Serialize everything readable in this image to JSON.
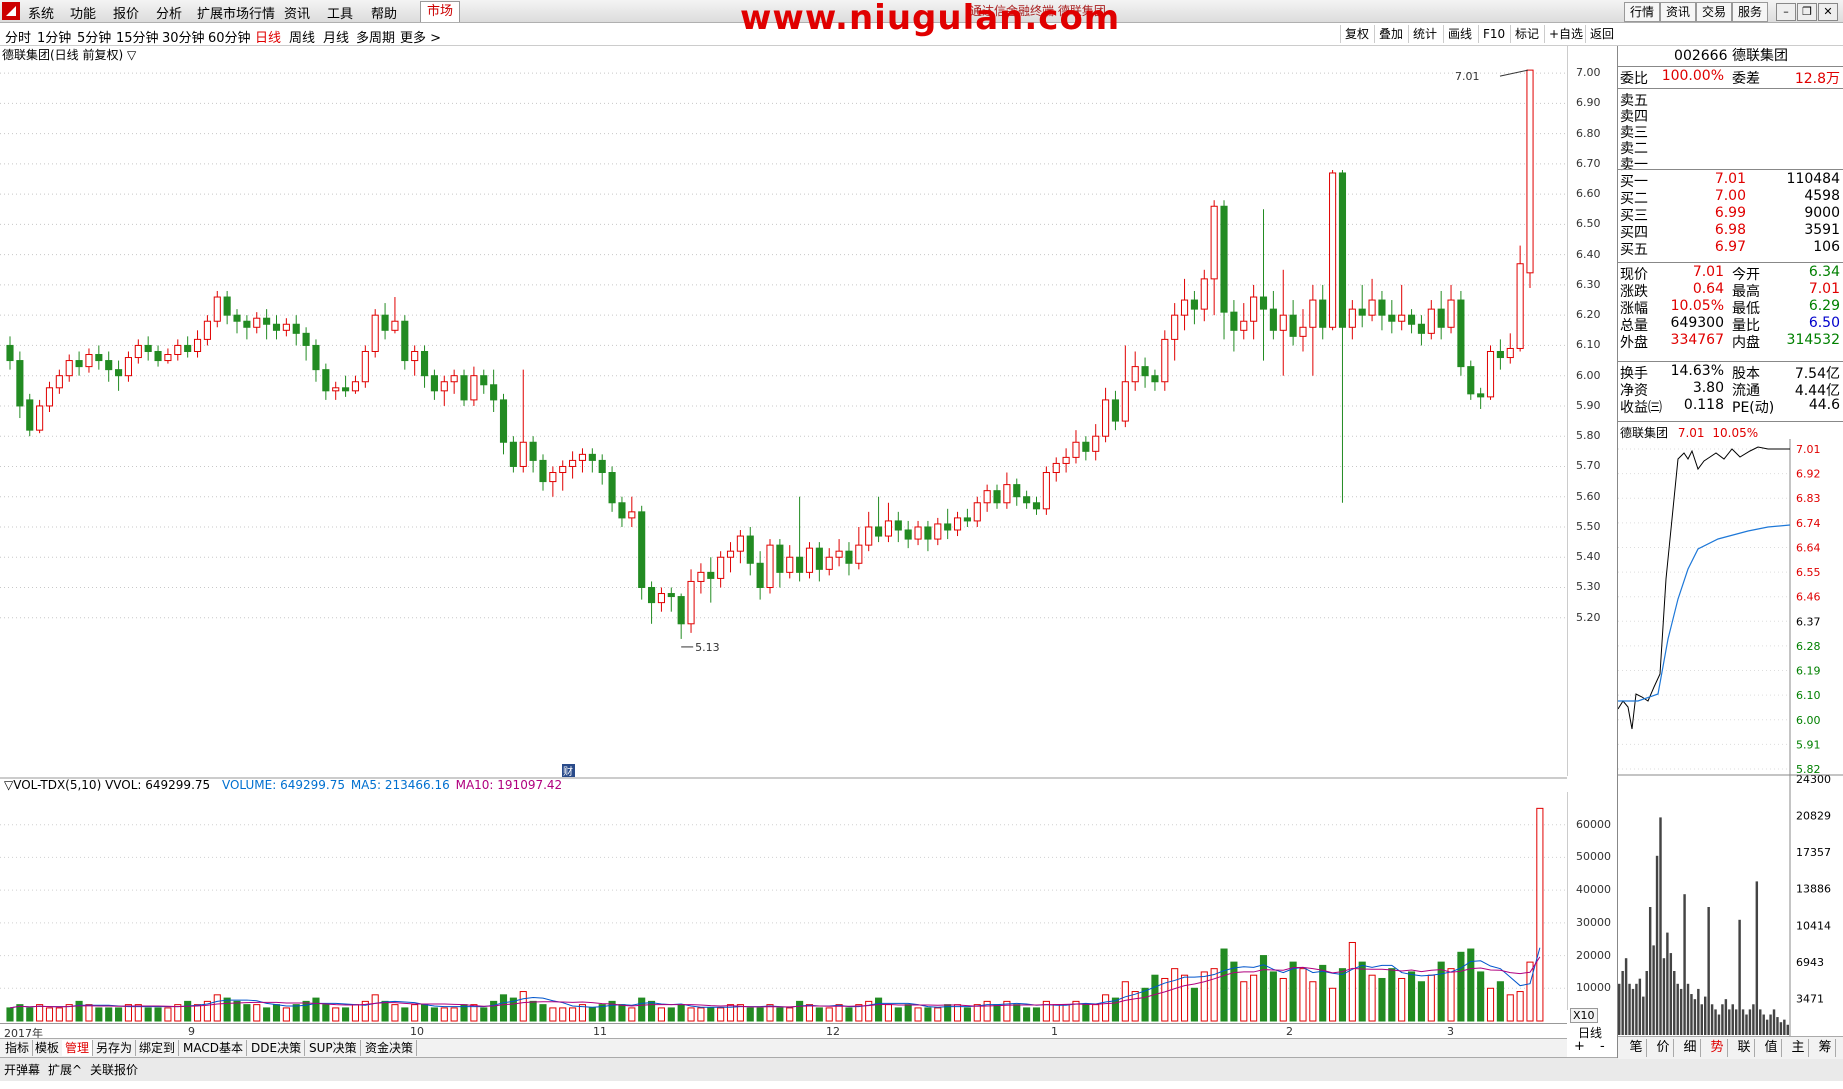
{
  "menu": {
    "items": [
      "系统",
      "功能",
      "报价",
      "分析",
      "扩展市场行情",
      "资讯",
      "工具",
      "帮助"
    ],
    "active": "市场",
    "watermark": "www.niugulan.com",
    "subtitle": "通达信金融终端 德联集团",
    "right_buttons": [
      "行情",
      "资讯",
      "交易",
      "服务"
    ]
  },
  "periodbar": {
    "periods": [
      "分时",
      "1分钟",
      "5分钟",
      "15分钟",
      "30分钟",
      "60分钟",
      "日线",
      "周线",
      "月线",
      "多周期",
      "更多 >"
    ],
    "active_period": "日线",
    "tools": [
      "复权",
      "叠加",
      "统计",
      "画线",
      "F10",
      "标记",
      "+自选",
      "返回"
    ]
  },
  "chart": {
    "title": "德联集团(日线 前复权) ▽",
    "price_labels": [
      "7.00",
      "6.90",
      "6.80",
      "6.70",
      "6.60",
      "6.50",
      "6.40",
      "6.30",
      "6.20",
      "6.10",
      "6.00",
      "5.90",
      "5.80",
      "5.70",
      "5.60",
      "5.50",
      "5.40",
      "5.30",
      "5.20"
    ],
    "high_marker": "7.01",
    "low_marker": "5.13",
    "finance_marker": "财",
    "vol_title_prefix": "▽VOL-TDX(5,10) VVOL: 649299.75",
    "vol_volume": "VOLUME: 649299.75",
    "vol_ma5": "MA5: 213466.16",
    "vol_ma10": "MA10: 191097.42",
    "vol_axis_labels": [
      "60000",
      "50000",
      "40000",
      "30000",
      "20000",
      "10000"
    ],
    "vol_unit": "X10",
    "date_labels": [
      "2017年",
      "9",
      "10",
      "11",
      "12",
      "1",
      "2",
      "3"
    ],
    "period_label": "日线",
    "colors": {
      "up": "#e00000",
      "down": "#228b22",
      "ma5": "#0055cc",
      "ma10": "#b0007f"
    }
  },
  "chart_data": {
    "type": "candlestick",
    "title": "德联集团(日线 前复权)",
    "ylim": [
      5.1,
      7.05
    ],
    "candles": [
      [
        6.1,
        6.05,
        6.13,
        6.02
      ],
      [
        6.05,
        5.9,
        6.08,
        5.86
      ],
      [
        5.92,
        5.82,
        5.94,
        5.8
      ],
      [
        5.82,
        5.9,
        5.92,
        5.81
      ],
      [
        5.9,
        5.96,
        5.98,
        5.88
      ],
      [
        5.96,
        6.0,
        6.02,
        5.94
      ],
      [
        6.0,
        6.05,
        6.07,
        5.98
      ],
      [
        6.05,
        6.03,
        6.08,
        6.0
      ],
      [
        6.03,
        6.07,
        6.09,
        6.01
      ],
      [
        6.07,
        6.05,
        6.1,
        6.02
      ],
      [
        6.05,
        6.02,
        6.08,
        5.98
      ],
      [
        6.02,
        6.0,
        6.05,
        5.95
      ],
      [
        6.0,
        6.06,
        6.08,
        5.98
      ],
      [
        6.06,
        6.1,
        6.12,
        6.04
      ],
      [
        6.1,
        6.08,
        6.13,
        6.05
      ],
      [
        6.08,
        6.05,
        6.1,
        6.03
      ],
      [
        6.05,
        6.07,
        6.09,
        6.04
      ],
      [
        6.07,
        6.1,
        6.12,
        6.05
      ],
      [
        6.1,
        6.08,
        6.13,
        6.06
      ],
      [
        6.08,
        6.12,
        6.15,
        6.06
      ],
      [
        6.12,
        6.18,
        6.2,
        6.1
      ],
      [
        6.18,
        6.26,
        6.28,
        6.16
      ],
      [
        6.26,
        6.2,
        6.28,
        6.17
      ],
      [
        6.2,
        6.18,
        6.22,
        6.14
      ],
      [
        6.18,
        6.16,
        6.2,
        6.12
      ],
      [
        6.16,
        6.19,
        6.21,
        6.14
      ],
      [
        6.19,
        6.17,
        6.22,
        6.12
      ],
      [
        6.17,
        6.15,
        6.2,
        6.12
      ],
      [
        6.15,
        6.17,
        6.19,
        6.13
      ],
      [
        6.17,
        6.14,
        6.2,
        6.1
      ],
      [
        6.14,
        6.1,
        6.16,
        6.05
      ],
      [
        6.1,
        6.02,
        6.12,
        5.98
      ],
      [
        6.02,
        5.95,
        6.04,
        5.92
      ],
      [
        5.95,
        5.96,
        5.98,
        5.92
      ],
      [
        5.96,
        5.95,
        6.0,
        5.93
      ],
      [
        5.95,
        5.98,
        6.0,
        5.94
      ],
      [
        5.98,
        6.08,
        6.1,
        5.96
      ],
      [
        6.08,
        6.2,
        6.22,
        6.06
      ],
      [
        6.2,
        6.15,
        6.24,
        6.12
      ],
      [
        6.15,
        6.18,
        6.26,
        6.14
      ],
      [
        6.18,
        6.05,
        6.2,
        6.02
      ],
      [
        6.05,
        6.08,
        6.1,
        6.0
      ],
      [
        6.08,
        6.0,
        6.1,
        5.96
      ],
      [
        6.0,
        5.95,
        6.02,
        5.92
      ],
      [
        5.95,
        5.98,
        6.0,
        5.9
      ],
      [
        5.98,
        6.0,
        6.02,
        5.94
      ],
      [
        6.0,
        5.92,
        6.02,
        5.9
      ],
      [
        5.92,
        6.0,
        6.03,
        5.9
      ],
      [
        6.0,
        5.97,
        6.02,
        5.94
      ],
      [
        5.97,
        5.92,
        6.02,
        5.88
      ],
      [
        5.92,
        5.78,
        5.94,
        5.74
      ],
      [
        5.78,
        5.7,
        5.8,
        5.68
      ],
      [
        5.7,
        5.78,
        6.02,
        5.68
      ],
      [
        5.78,
        5.72,
        5.8,
        5.68
      ],
      [
        5.72,
        5.65,
        5.74,
        5.62
      ],
      [
        5.65,
        5.68,
        5.7,
        5.6
      ],
      [
        5.68,
        5.7,
        5.72,
        5.62
      ],
      [
        5.7,
        5.72,
        5.75,
        5.66
      ],
      [
        5.72,
        5.74,
        5.76,
        5.68
      ],
      [
        5.74,
        5.72,
        5.76,
        5.68
      ],
      [
        5.72,
        5.68,
        5.74,
        5.64
      ],
      [
        5.68,
        5.58,
        5.7,
        5.55
      ],
      [
        5.58,
        5.53,
        5.6,
        5.5
      ],
      [
        5.53,
        5.55,
        5.6,
        5.5
      ],
      [
        5.55,
        5.3,
        5.57,
        5.26
      ],
      [
        5.3,
        5.25,
        5.32,
        5.18
      ],
      [
        5.25,
        5.28,
        5.3,
        5.22
      ],
      [
        5.28,
        5.27,
        5.3,
        5.22
      ],
      [
        5.27,
        5.18,
        5.28,
        5.13
      ],
      [
        5.18,
        5.32,
        5.36,
        5.15
      ],
      [
        5.32,
        5.35,
        5.38,
        5.28
      ],
      [
        5.35,
        5.33,
        5.4,
        5.25
      ],
      [
        5.33,
        5.4,
        5.42,
        5.3
      ],
      [
        5.4,
        5.42,
        5.45,
        5.35
      ],
      [
        5.42,
        5.47,
        5.49,
        5.38
      ],
      [
        5.47,
        5.38,
        5.5,
        5.34
      ],
      [
        5.38,
        5.3,
        5.42,
        5.26
      ],
      [
        5.3,
        5.44,
        5.46,
        5.28
      ],
      [
        5.44,
        5.35,
        5.46,
        5.3
      ],
      [
        5.35,
        5.4,
        5.44,
        5.33
      ],
      [
        5.4,
        5.35,
        5.6,
        5.32
      ],
      [
        5.35,
        5.43,
        5.45,
        5.33
      ],
      [
        5.43,
        5.36,
        5.45,
        5.32
      ],
      [
        5.36,
        5.4,
        5.43,
        5.34
      ],
      [
        5.4,
        5.42,
        5.46,
        5.37
      ],
      [
        5.42,
        5.38,
        5.45,
        5.34
      ],
      [
        5.38,
        5.44,
        5.5,
        5.36
      ],
      [
        5.44,
        5.5,
        5.55,
        5.42
      ],
      [
        5.5,
        5.47,
        5.6,
        5.45
      ],
      [
        5.47,
        5.52,
        5.58,
        5.45
      ],
      [
        5.52,
        5.49,
        5.55,
        5.45
      ],
      [
        5.49,
        5.46,
        5.52,
        5.43
      ],
      [
        5.46,
        5.5,
        5.52,
        5.44
      ],
      [
        5.5,
        5.46,
        5.52,
        5.42
      ],
      [
        5.46,
        5.51,
        5.53,
        5.44
      ],
      [
        5.51,
        5.49,
        5.56,
        5.46
      ],
      [
        5.49,
        5.53,
        5.55,
        5.47
      ],
      [
        5.53,
        5.52,
        5.56,
        5.5
      ],
      [
        5.52,
        5.58,
        5.6,
        5.5
      ],
      [
        5.58,
        5.62,
        5.64,
        5.55
      ],
      [
        5.62,
        5.58,
        5.64,
        5.56
      ],
      [
        5.58,
        5.64,
        5.68,
        5.56
      ],
      [
        5.64,
        5.6,
        5.66,
        5.57
      ],
      [
        5.6,
        5.58,
        5.62,
        5.56
      ],
      [
        5.58,
        5.56,
        5.6,
        5.54
      ],
      [
        5.56,
        5.68,
        5.7,
        5.54
      ],
      [
        5.68,
        5.71,
        5.73,
        5.65
      ],
      [
        5.71,
        5.73,
        5.76,
        5.68
      ],
      [
        5.73,
        5.78,
        5.82,
        5.71
      ],
      [
        5.78,
        5.75,
        5.8,
        5.72
      ],
      [
        5.75,
        5.8,
        5.84,
        5.72
      ],
      [
        5.8,
        5.92,
        5.96,
        5.78
      ],
      [
        5.92,
        5.85,
        5.95,
        5.82
      ],
      [
        5.85,
        5.98,
        6.1,
        5.83
      ],
      [
        5.98,
        6.03,
        6.08,
        5.95
      ],
      [
        6.03,
        6.0,
        6.06,
        5.96
      ],
      [
        6.0,
        5.98,
        6.02,
        5.95
      ],
      [
        5.98,
        6.12,
        6.15,
        5.95
      ],
      [
        6.12,
        6.2,
        6.24,
        6.05
      ],
      [
        6.2,
        6.25,
        6.32,
        6.15
      ],
      [
        6.25,
        6.22,
        6.28,
        6.17
      ],
      [
        6.22,
        6.32,
        6.35,
        6.18
      ],
      [
        6.32,
        6.56,
        6.58,
        6.2
      ],
      [
        6.56,
        6.21,
        6.58,
        6.12
      ],
      [
        6.21,
        6.15,
        6.25,
        6.08
      ],
      [
        6.15,
        6.18,
        6.24,
        6.12
      ],
      [
        6.18,
        6.26,
        6.3,
        6.12
      ],
      [
        6.26,
        6.22,
        6.55,
        6.05
      ],
      [
        6.22,
        6.15,
        6.28,
        6.12
      ],
      [
        6.15,
        6.2,
        6.35,
        6.0
      ],
      [
        6.2,
        6.13,
        6.25,
        6.1
      ],
      [
        6.13,
        6.16,
        6.22,
        6.08
      ],
      [
        6.16,
        6.25,
        6.3,
        6.0
      ],
      [
        6.25,
        6.16,
        6.3,
        6.12
      ],
      [
        6.16,
        6.67,
        6.68,
        6.15
      ],
      [
        6.67,
        6.16,
        6.68,
        5.58
      ],
      [
        6.16,
        6.22,
        6.25,
        6.12
      ],
      [
        6.22,
        6.2,
        6.3,
        6.16
      ],
      [
        6.2,
        6.25,
        6.32,
        6.18
      ],
      [
        6.25,
        6.2,
        6.28,
        6.15
      ],
      [
        6.2,
        6.18,
        6.25,
        6.14
      ],
      [
        6.18,
        6.2,
        6.3,
        6.15
      ],
      [
        6.2,
        6.17,
        6.22,
        6.14
      ],
      [
        6.17,
        6.14,
        6.2,
        6.1
      ],
      [
        6.14,
        6.22,
        6.25,
        6.12
      ],
      [
        6.22,
        6.16,
        6.28,
        6.12
      ],
      [
        6.16,
        6.25,
        6.3,
        6.14
      ],
      [
        6.25,
        6.03,
        6.28,
        6.0
      ],
      [
        6.03,
        5.94,
        6.05,
        5.92
      ],
      [
        5.94,
        5.93,
        5.96,
        5.89
      ],
      [
        5.93,
        6.08,
        6.1,
        5.92
      ],
      [
        6.08,
        6.06,
        6.12,
        6.02
      ],
      [
        6.06,
        6.09,
        6.14,
        6.04
      ],
      [
        6.09,
        6.37,
        6.43,
        6.08
      ],
      [
        6.34,
        7.01,
        7.01,
        6.29
      ]
    ],
    "volume": [
      4,
      5,
      4,
      5,
      4,
      4,
      5,
      6,
      5,
      4,
      4,
      4,
      5,
      5,
      4,
      4,
      4,
      5,
      6,
      5,
      6,
      8,
      7,
      6,
      5,
      5,
      4,
      5,
      4,
      5,
      6,
      7,
      5,
      4,
      4,
      5,
      6,
      8,
      6,
      5,
      4,
      5,
      5,
      4,
      4,
      4,
      5,
      5,
      4,
      6,
      8,
      7,
      9,
      6,
      5,
      4,
      4,
      4,
      5,
      4,
      5,
      6,
      5,
      4,
      7,
      6,
      4,
      4,
      5,
      4,
      4,
      4,
      4,
      5,
      5,
      4,
      4,
      5,
      4,
      4,
      6,
      5,
      4,
      4,
      5,
      4,
      5,
      6,
      7,
      5,
      4,
      5,
      4,
      4,
      4,
      5,
      5,
      4,
      5,
      6,
      5,
      6,
      5,
      4,
      4,
      6,
      5,
      5,
      6,
      5,
      5,
      8,
      7,
      12,
      9,
      10,
      14,
      13,
      16,
      14,
      10,
      15,
      16,
      22,
      18,
      12,
      14,
      20,
      15,
      13,
      18,
      16,
      12,
      17,
      10,
      16,
      24,
      18,
      14,
      13,
      16,
      13,
      15,
      12,
      14,
      18,
      16,
      21,
      22,
      15,
      10,
      12,
      8,
      9,
      18,
      65
    ],
    "ma5_label": "MA5: 213466.16",
    "ma10_label": "MA10: 191097.42",
    "volume_scale": "X10"
  },
  "quote": {
    "code_name": "002666 德联集团",
    "webi_label": "委比",
    "webi_val": "100.00%",
    "weicha_label": "委差",
    "weicha_val": "12.8万",
    "asks": [
      {
        "label": "卖五",
        "price": "",
        "vol": ""
      },
      {
        "label": "卖四",
        "price": "",
        "vol": ""
      },
      {
        "label": "卖三",
        "price": "",
        "vol": ""
      },
      {
        "label": "卖二",
        "price": "",
        "vol": ""
      },
      {
        "label": "卖一",
        "price": "",
        "vol": ""
      }
    ],
    "bids": [
      {
        "label": "买一",
        "price": "7.01",
        "vol": "110484"
      },
      {
        "label": "买二",
        "price": "7.00",
        "vol": "4598"
      },
      {
        "label": "买三",
        "price": "6.99",
        "vol": "9000"
      },
      {
        "label": "买四",
        "price": "6.98",
        "vol": "3591"
      },
      {
        "label": "买五",
        "price": "6.97",
        "vol": "106"
      }
    ],
    "stats": [
      {
        "k": "现价",
        "v": "7.01",
        "vc": "red",
        "k2": "今开",
        "v2": "6.34",
        "v2c": "green"
      },
      {
        "k": "涨跌",
        "v": "0.64",
        "vc": "red",
        "k2": "最高",
        "v2": "7.01",
        "v2c": "red"
      },
      {
        "k": "涨幅",
        "v": "10.05%",
        "vc": "red",
        "k2": "最低",
        "v2": "6.29",
        "v2c": "green"
      },
      {
        "k": "总量",
        "v": "649300",
        "vc": "",
        "k2": "量比",
        "v2": "6.50",
        "v2c": "blue"
      },
      {
        "k": "外盘",
        "v": "334767",
        "vc": "red",
        "k2": "内盘",
        "v2": "314532",
        "v2c": "green"
      }
    ],
    "stats2": [
      {
        "k": "换手",
        "v": "14.63%",
        "k2": "股本",
        "v2": "7.54亿"
      },
      {
        "k": "净资",
        "v": "3.80",
        "k2": "流通",
        "v2": "4.44亿"
      },
      {
        "k": "收益㈢",
        "v": "0.118",
        "k2": "PE(动)",
        "v2": "44.6"
      }
    ],
    "mini_title": "德联集团",
    "mini_price": "7.01",
    "mini_pct": "10.05%",
    "mini_right_labels": [
      "7.01",
      "6.92",
      "6.83",
      "6.74",
      "6.64",
      "6.55",
      "6.46",
      "6.37",
      "6.28",
      "6.19",
      "6.10",
      "6.00",
      "5.91",
      "5.82"
    ],
    "mini_vol_labels": [
      "24300",
      "20829",
      "17357",
      "13886",
      "10414",
      "6943",
      "3471"
    ],
    "bottom_tabs": [
      "笔",
      "价",
      "细",
      "势",
      "联",
      "值",
      "主",
      "筹"
    ],
    "active_tab": "势"
  },
  "bottom": {
    "tabs": [
      "指标",
      "模板",
      "管理",
      "另存为",
      "绑定到",
      "MACD基本",
      "DDE决策",
      "SUP决策",
      "资金决策"
    ],
    "active_tab": "管理",
    "status_items": [
      "开弹幕",
      "扩展^",
      "关联报价"
    ]
  }
}
